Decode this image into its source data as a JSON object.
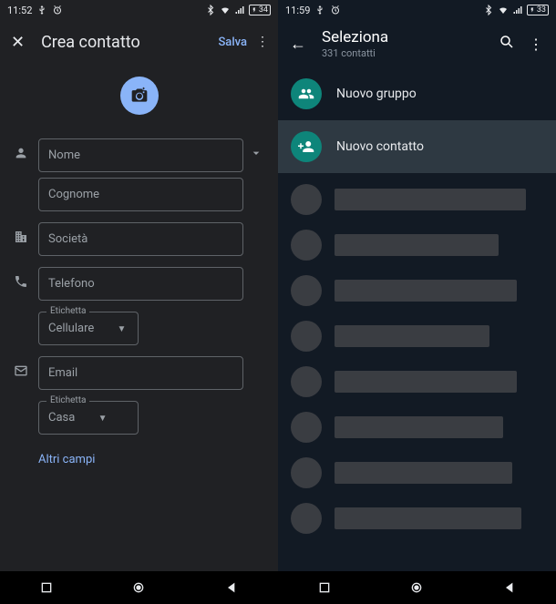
{
  "left": {
    "status": {
      "time": "11:52",
      "battery": "34"
    },
    "header": {
      "title": "Crea contatto",
      "save": "Salva"
    },
    "fields": {
      "nome": "Nome",
      "cognome": "Cognome",
      "societa": "Società",
      "telefono": "Telefono",
      "telefono_etichetta_label": "Etichetta",
      "telefono_etichetta": "Cellulare",
      "email": "Email",
      "email_etichetta_label": "Etichetta",
      "email_etichetta": "Casa"
    },
    "more_fields": "Altri campi"
  },
  "right": {
    "status": {
      "time": "11:59",
      "battery": "33"
    },
    "header": {
      "title": "Seleziona",
      "subtitle": "331 contatti"
    },
    "actions": {
      "new_group": "Nuovo gruppo",
      "new_contact": "Nuovo contatto"
    },
    "placeholder_widths": [
      210,
      180,
      200,
      170,
      200,
      185,
      195,
      205
    ]
  }
}
